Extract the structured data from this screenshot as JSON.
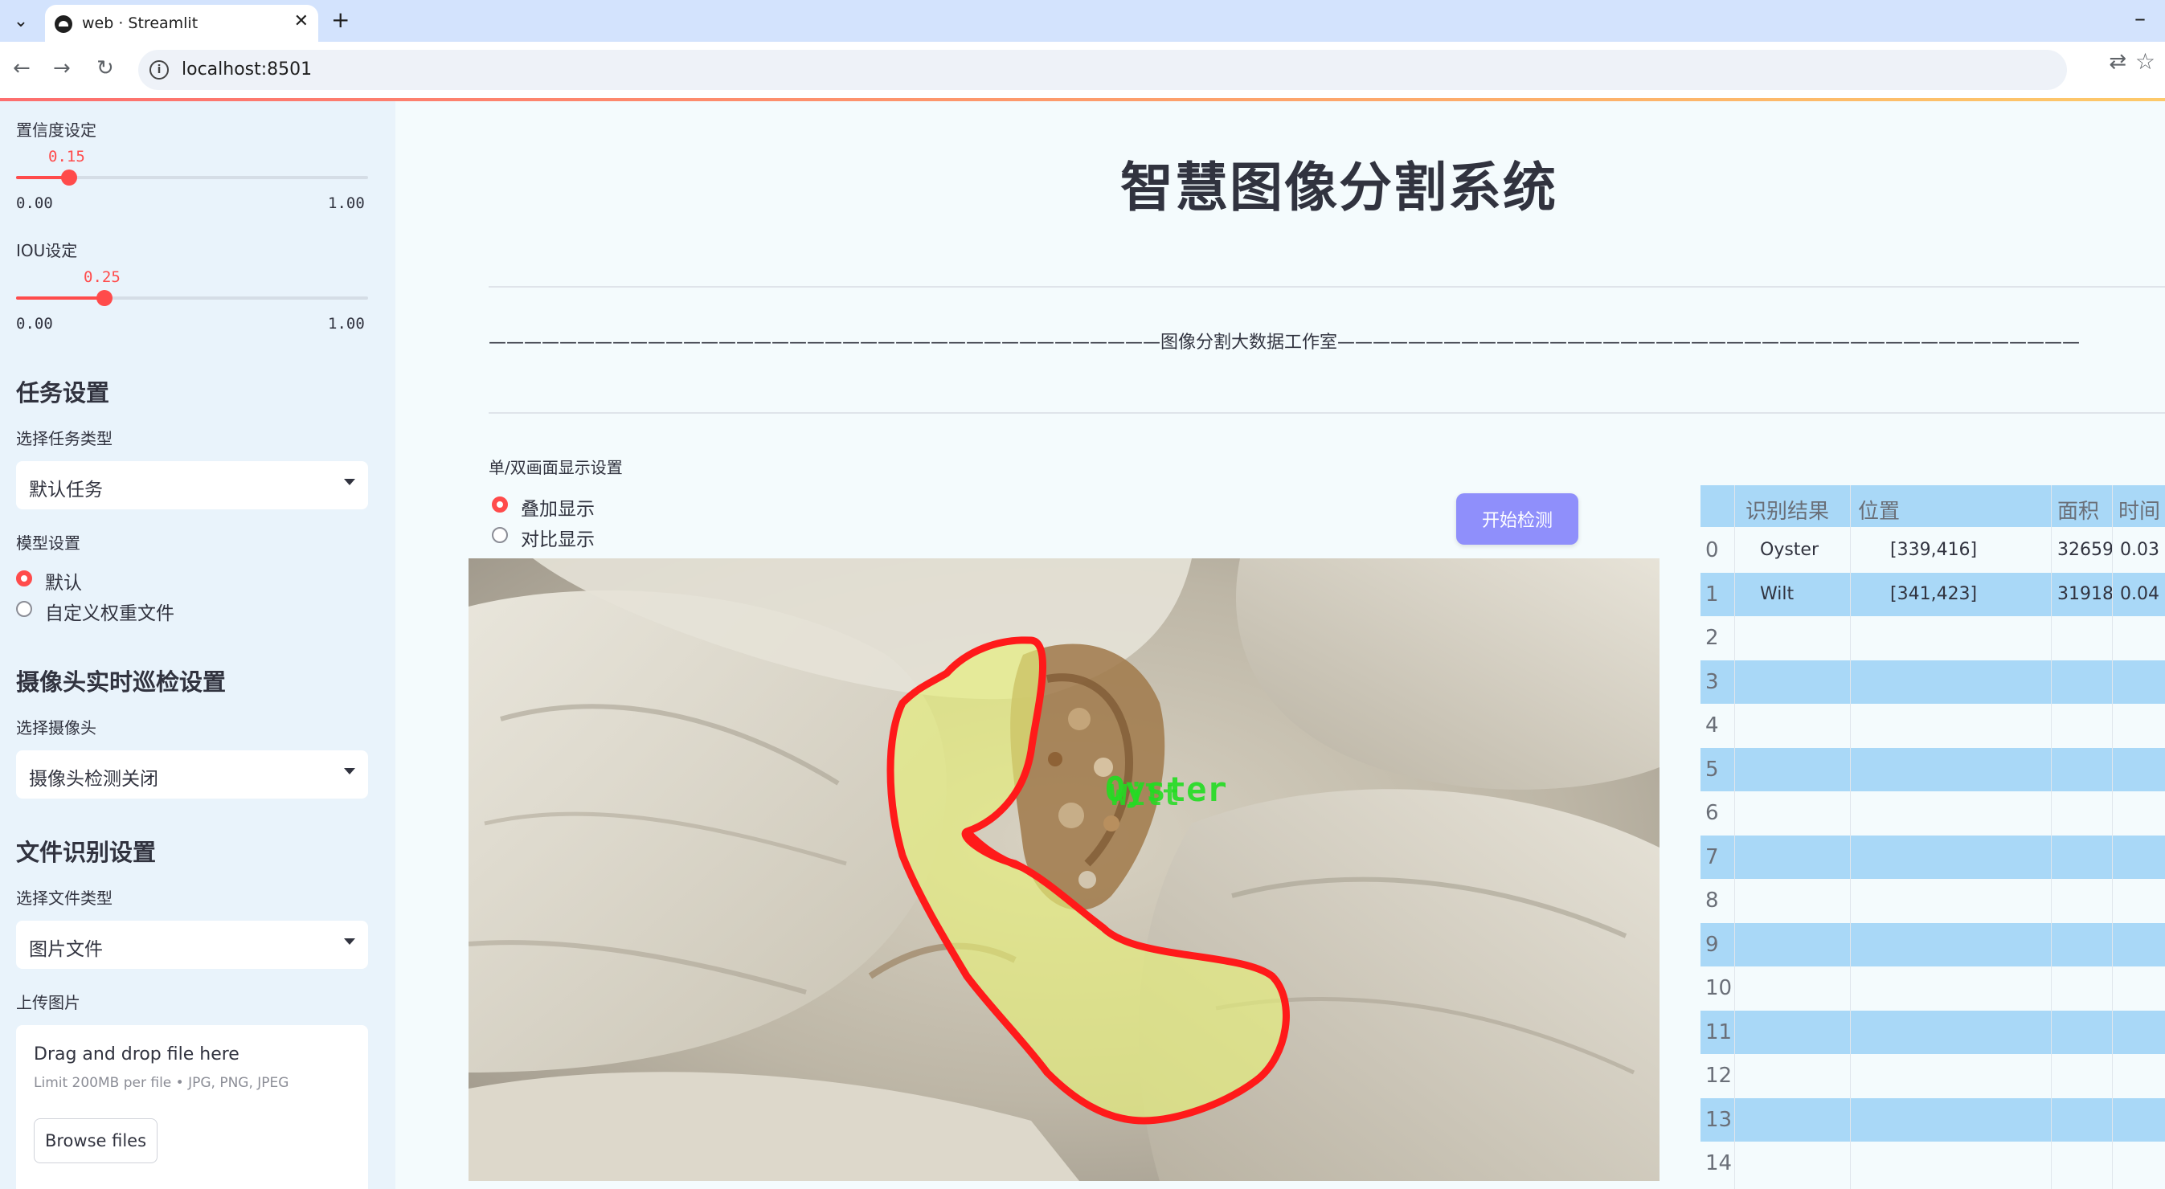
{
  "browser": {
    "tab_title": "web · Streamlit",
    "url": "localhost:8501"
  },
  "sidebar": {
    "confidence": {
      "label": "置信度设定",
      "value": "0.15",
      "value_num": 0.15,
      "min": "0.00",
      "max": "1.00"
    },
    "iou": {
      "label": "IOU设定",
      "value": "0.25",
      "value_num": 0.25,
      "min": "0.00",
      "max": "1.00"
    },
    "task": {
      "heading": "任务设置",
      "label": "选择任务类型",
      "selected": "默认任务"
    },
    "model": {
      "label": "模型设置",
      "options": [
        "默认",
        "自定义权重文件"
      ],
      "selected_index": 0
    },
    "camera": {
      "heading": "摄像头实时巡检设置",
      "label": "选择摄像头",
      "selected": "摄像头检测关闭"
    },
    "file": {
      "heading": "文件识别设置",
      "label": "选择文件类型",
      "selected": "图片文件"
    },
    "upload": {
      "label": "上传图片",
      "title": "Drag and drop file here",
      "subtitle": "Limit 200MB per file • JPG, PNG, JPEG",
      "button": "Browse files"
    }
  },
  "main": {
    "title": "智慧图像分割系统",
    "divider": "——————————————————————————————————————图像分割大数据工作室——————————————————————————————————————————",
    "display_mode": {
      "label": "单/双画面显示设置",
      "options": [
        "叠加显示",
        "对比显示"
      ],
      "selected_index": 0
    },
    "start_button": "开始检测",
    "overlay_labels": [
      "Oyster",
      "Wilt"
    ],
    "colors": {
      "accent": "#ff4b4b",
      "mask_outline": "#ff1a1a",
      "mask_fill": "#e6ef7a",
      "label_text": "#22dd22",
      "primary_button": "#8f8ffb"
    }
  },
  "table": {
    "columns": [
      "识别结果",
      "位置",
      "面积",
      "时间"
    ],
    "rows": [
      {
        "index": "0",
        "result": "Oyster",
        "position": "[339,416]",
        "area": "32659",
        "time": "0.03"
      },
      {
        "index": "1",
        "result": "Wilt",
        "position": "[341,423]",
        "area": "31918",
        "time": "0.04"
      },
      {
        "index": "2",
        "result": "",
        "position": "",
        "area": "",
        "time": ""
      },
      {
        "index": "3",
        "result": "",
        "position": "",
        "area": "",
        "time": ""
      },
      {
        "index": "4",
        "result": "",
        "position": "",
        "area": "",
        "time": ""
      },
      {
        "index": "5",
        "result": "",
        "position": "",
        "area": "",
        "time": ""
      },
      {
        "index": "6",
        "result": "",
        "position": "",
        "area": "",
        "time": ""
      },
      {
        "index": "7",
        "result": "",
        "position": "",
        "area": "",
        "time": ""
      },
      {
        "index": "8",
        "result": "",
        "position": "",
        "area": "",
        "time": ""
      },
      {
        "index": "9",
        "result": "",
        "position": "",
        "area": "",
        "time": ""
      },
      {
        "index": "10",
        "result": "",
        "position": "",
        "area": "",
        "time": ""
      },
      {
        "index": "11",
        "result": "",
        "position": "",
        "area": "",
        "time": ""
      },
      {
        "index": "12",
        "result": "",
        "position": "",
        "area": "",
        "time": ""
      },
      {
        "index": "13",
        "result": "",
        "position": "",
        "area": "",
        "time": ""
      },
      {
        "index": "14",
        "result": "",
        "position": "",
        "area": "",
        "time": ""
      }
    ]
  }
}
